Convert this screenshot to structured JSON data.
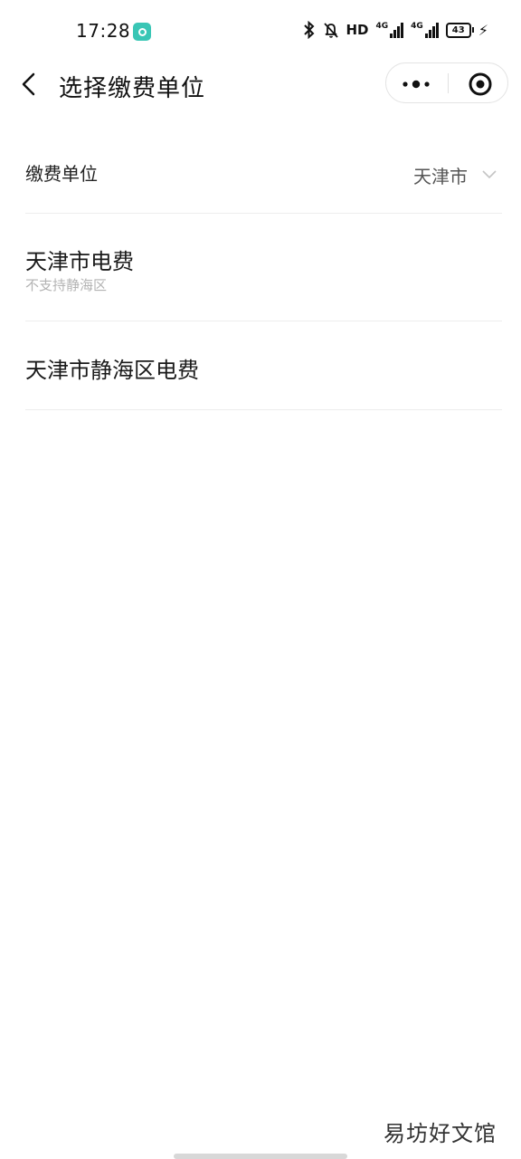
{
  "status_bar": {
    "time": "17:28",
    "hd_label": "HD",
    "signal_1_label": "4G",
    "signal_2_label": "4G",
    "battery_level": "43"
  },
  "nav": {
    "title": "选择缴费单位"
  },
  "selector": {
    "label": "缴费单位",
    "value": "天津市"
  },
  "units": [
    {
      "name": "天津市电费",
      "note": "不支持静海区"
    },
    {
      "name": "天津市静海区电费"
    }
  ],
  "watermark": "易坊好文馆",
  "colors": {
    "accent_status_icon": "#39c6b5",
    "divider": "#ededed",
    "secondary_text": "#b3b3b3"
  }
}
